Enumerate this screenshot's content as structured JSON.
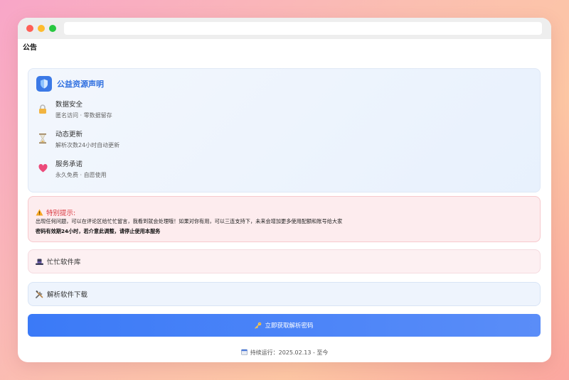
{
  "page_title": "公告",
  "notice": {
    "title": "公益资源声明",
    "features": [
      {
        "icon": "lock-icon",
        "name": "数据安全",
        "desc": "匿名访问 · 零数据留存"
      },
      {
        "icon": "hourglass-icon",
        "name": "动态更新",
        "desc": "解析次数24小时自动更新"
      },
      {
        "icon": "heart-icon",
        "name": "服务承诺",
        "desc": "永久免费 · 自愿使用"
      }
    ]
  },
  "warning": {
    "title": "特别提示:",
    "line1": "出现任何问题，可以在评论区给忙忙留言，我看到就会处理哦！如果对你有用，可以三连支持下，未来会增加更多使用配额和账号给大家",
    "line2": "密码有效期24小时，若介意此调整，请停止使用本服务"
  },
  "library": {
    "label": "忙忙软件库"
  },
  "download": {
    "label": "解析软件下载"
  },
  "cta": {
    "label": "立即获取解析密码"
  },
  "footer": {
    "label": "持续运行：",
    "date": "2025.02.13 - 至今"
  },
  "colors": {
    "accent": "#3b79e6",
    "warning": "#d9363e",
    "cta": "#3b7af7"
  }
}
